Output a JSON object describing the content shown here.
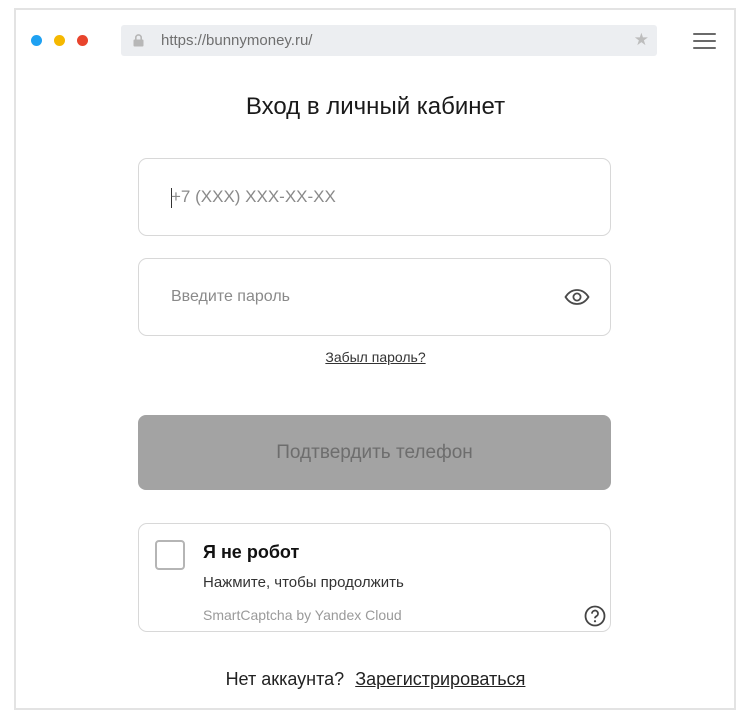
{
  "browser": {
    "url": "https://bunnymoney.ru/",
    "dots": [
      "#1ea1f2",
      "#f5b800",
      "#e8442c"
    ],
    "star_icon": "star-icon",
    "menu_icon": "hamburger-menu-icon"
  },
  "login": {
    "title": "Вход в личный кабинет",
    "phone_placeholder": "+7 (XXX) XXX-XX-XX",
    "password_placeholder": "Введите пароль",
    "forgot_link": "Забыл пароль?",
    "submit_label": "Подтвердить телефон"
  },
  "captcha": {
    "title": "Я не робот",
    "subtitle": "Нажмите, чтобы продолжить",
    "brand": "SmartCaptcha by Yandex Cloud"
  },
  "footer": {
    "question": "Нет аккаунта?",
    "register_link": "Зарегистрироваться"
  }
}
